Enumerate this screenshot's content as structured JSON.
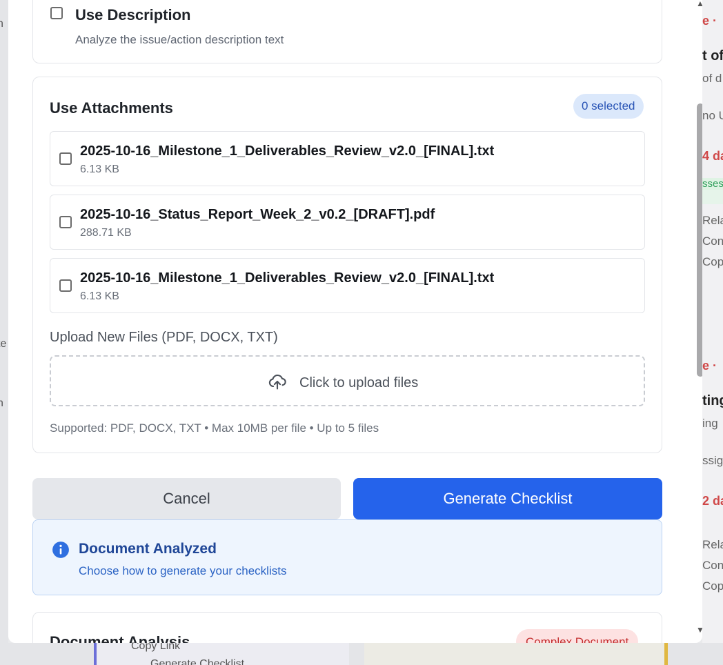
{
  "background": {
    "right_fragments": [
      "e · ",
      "t of",
      "of d",
      "no U",
      "4 da",
      "sses",
      "Rela",
      "Con",
      "Cop",
      "e · ",
      "ting",
      "ing",
      "ssig",
      "2 da",
      "Rela",
      "Con",
      "Cop"
    ],
    "left_fragments": [
      "n",
      "te",
      "n"
    ],
    "bottom_fragments": [
      "Copy Link",
      "Generate Checklist"
    ]
  },
  "use_description": {
    "title": "Use Description",
    "subtitle": "Analyze the issue/action description text",
    "checked": false
  },
  "attachments": {
    "title": "Use Attachments",
    "selected_badge": "0 selected",
    "files": [
      {
        "name": "2025-10-16_Milestone_1_Deliverables_Review_v2.0_[FINAL].txt",
        "size": "6.13 KB",
        "checked": false
      },
      {
        "name": "2025-10-16_Status_Report_Week_2_v0.2_[DRAFT].pdf",
        "size": "288.71 KB",
        "checked": false
      },
      {
        "name": "2025-10-16_Milestone_1_Deliverables_Review_v2.0_[FINAL].txt",
        "size": "6.13 KB",
        "checked": false
      }
    ],
    "upload_label": "Upload New Files (PDF, DOCX, TXT)",
    "upload_prompt": "Click to upload files",
    "supported_text": "Supported: PDF, DOCX, TXT • Max 10MB per file • Up to 5 files"
  },
  "actions": {
    "cancel_label": "Cancel",
    "generate_label": "Generate Checklist",
    "generate_color": "#2563eb"
  },
  "notice": {
    "title": "Document Analyzed",
    "subtitle": "Choose how to generate your checklists",
    "icon": "info-icon"
  },
  "analysis": {
    "title": "Document Analysis",
    "complexity_badge": "Complex Document"
  }
}
